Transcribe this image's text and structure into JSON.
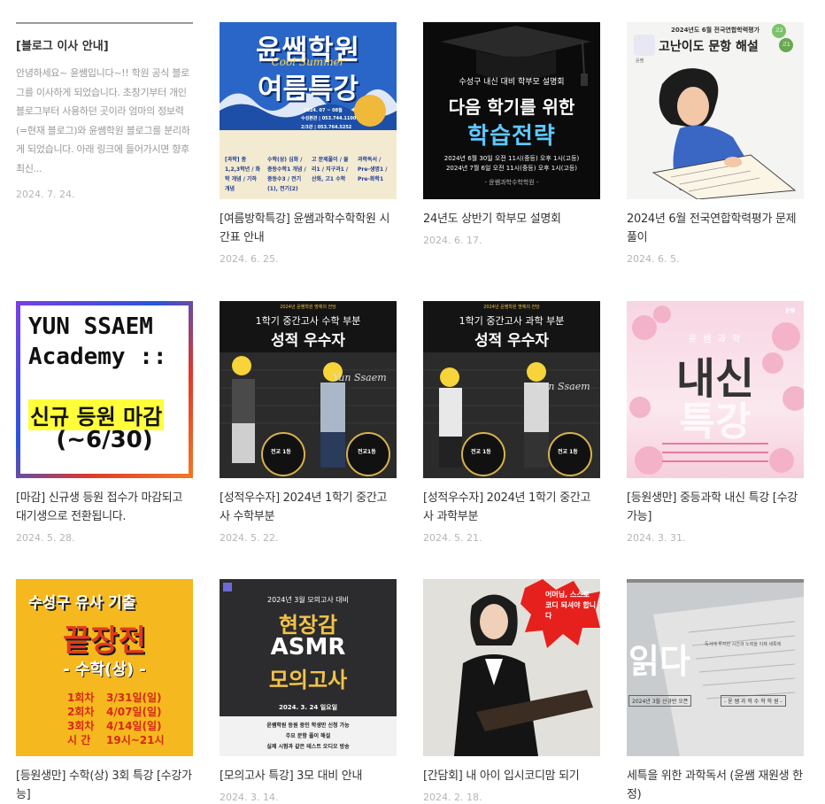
{
  "posts": [
    {
      "title": "[블로그 이사 안내]",
      "excerpt": "안녕하세요~ 윤쌤입니다~!! 학원 공식 블로그를 이사하게 되었습니다. 초창기부터 개인블로그부터 사용하던 곳이라 엄마의 정보력(=현재 블로그)와 윤쌤학원 블로그를 분리하게 되었습니다. 아래 링크에 들어가시면 향후 최신...",
      "date": "2024. 7. 24."
    },
    {
      "title": "[여름방학특강] 윤쌤과학수학학원 시간표 안내",
      "date": "2024. 6. 25.",
      "thumb": {
        "line1": "윤쌤학원",
        "line2": "여름특강",
        "script": "Cool Summer",
        "dates": "2024. 07 ~ 08월",
        "phone1": "수성본관 | 053.744.1100",
        "phone2": "2/3관 | 053.764.5252",
        "col1": "[과학] 중1,2,3학년 / 화학 개념 / 기하 개념",
        "col2": "수학(상) 심화 / 중등수학1 개념 / 중등수3 / 전기(1), 전기(2)",
        "col3": "고 문제풀이 / 물리1 / 지구과1 / 산화, 고1 수학",
        "col4": "과학독서 / Pre-생명1 / Pre-화학1"
      }
    },
    {
      "title": "24년도 상반기 학부모 설명회",
      "date": "2024. 6. 17.",
      "thumb": {
        "sub": "수성구 내신 대비 학부모 설명회",
        "line1": "다음 학기를 위한",
        "line2": "학습전략",
        "d1": "2024년 6월 30일 오전 11시(중등) 오후 1시(고등)",
        "d2": "2024년 7월 6일 오전 11시(중등) 오후 1시(고등)",
        "brand": "- 윤쌤과학수학학원 -"
      }
    },
    {
      "title": "2024년 6월 전국연합학력평가 문제풀이",
      "date": "2024. 6. 5.",
      "thumb": {
        "top": "2024년도 6월 전국연합학력평가",
        "main": "고난이도 문항 해설",
        "badge1": "고1",
        "badge2": "고2",
        "logo": "윤쌤"
      }
    },
    {
      "title": "[마감] 신규생 등원 접수가 마감되고 대기생으로 전환됩니다.",
      "date": "2024. 5. 28.",
      "thumb": {
        "l1": "YUN SSAEM",
        "l2": "Academy  ::",
        "l3": "신규 등원 마감",
        "l4": "(~6/30)"
      }
    },
    {
      "title": "[성적우수자] 2024년 1학기 중간고사 수학부분",
      "date": "2024. 5. 22.",
      "thumb": {
        "top": "2024년 윤쌤학원 명예의 전당",
        "l1": "1학기 중간고사 수학 부분",
        "l2": "성적 우수자",
        "medal1": "전교 1등",
        "medal2": "전교1등",
        "wall": "Yun Ssaem"
      }
    },
    {
      "title": "[성적우수자] 2024년 1학기 중간고사 과학부분",
      "date": "2024. 5. 21.",
      "thumb": {
        "top": "2024년 윤쌤학원 명예의 전당",
        "l1": "1학기 중간고사 과학 부분",
        "l2": "성적 우수자",
        "medal1": "전교 1등",
        "medal2": "전교 1등",
        "wall": "Yun Ssaem"
      }
    },
    {
      "title": "[등원생만] 중등과학 내신 특강 [수강가능]",
      "date": "2024. 3. 31.",
      "thumb": {
        "sub": "윤 쌤 과 학",
        "l1": "내신",
        "l2": "특강",
        "logo": "윤쌤"
      }
    },
    {
      "title": "[등원생만] 수학(상) 3회 특강 [수강가능]",
      "date": "",
      "thumb": {
        "top": "수성구 유사 기출",
        "main": "끝장전",
        "sub": "- 수학(상) -",
        "r1": "1회차",
        "r1d": "3/31일(일)",
        "r2": "2회차",
        "r2d": "4/07일(일)",
        "r3": "3회차",
        "r3d": "4/14일(일)",
        "r4": "시 간",
        "r4d": "19시~21시"
      }
    },
    {
      "title": "[모의고사 특강] 3모 대비 안내",
      "date": "2024. 3. 14.",
      "thumb": {
        "top": "2024년 3월 모의고사 대비",
        "l1": "현장감",
        "l2": "ASMR",
        "l3": "모의고사",
        "date": "2024. 3. 24 일요일",
        "b1": "윤쌤학원 등원 중인 학생만 신청 가능",
        "b2": "주요 문항 풀이 해설",
        "b3": "실제 시험과 같은 테스트 오디오 방송"
      }
    },
    {
      "title": "[간담회] 내 아이 입시코디맘 되기",
      "date": "2024. 2. 18.",
      "thumb": {
        "bubble": "어머님, 스스로 코디 되셔야 합니다"
      }
    },
    {
      "title": "세특을 위한 과학독서 (윤쌤 재원생 한정)",
      "date": "",
      "thumb": {
        "big": "읽다",
        "small": "독서에 투자한 시간과 노력을 이제 세특에",
        "label1": "2024년 3월 신규반 오픈",
        "label2": "- 윤 쌤 과 학 수 학 학 원 -"
      }
    }
  ]
}
